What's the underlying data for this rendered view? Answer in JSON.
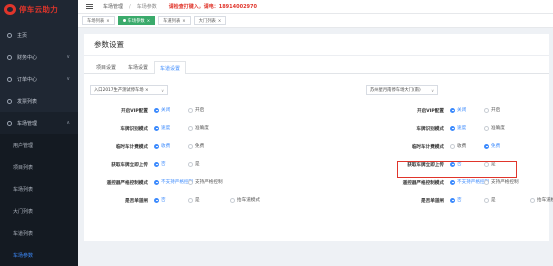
{
  "brand": {
    "name": "停车云助力"
  },
  "sidebar": {
    "items": [
      {
        "label": "主页"
      },
      {
        "label": "财务中心"
      },
      {
        "label": "订单中心"
      },
      {
        "label": "发票列表"
      },
      {
        "label": "车场管理"
      }
    ],
    "sub_items": [
      {
        "label": "用户管理"
      },
      {
        "label": "项目列表"
      },
      {
        "label": "车场列表"
      },
      {
        "label": "大门列表"
      },
      {
        "label": "车道列表"
      },
      {
        "label": "车场参数"
      }
    ]
  },
  "header": {
    "breadcrumb": [
      "车场管理",
      "车场参数"
    ],
    "notice": "请检查打键入，请电：18914002970"
  },
  "tags": [
    {
      "label": "车场列表"
    },
    {
      "label": "车场参数"
    },
    {
      "label": "车道列表"
    },
    {
      "label": "大门列表"
    }
  ],
  "page": {
    "title": "参数设置",
    "tabs": [
      {
        "label": "项目设置"
      },
      {
        "label": "车场设置"
      },
      {
        "label": "车道设置"
      }
    ],
    "select_left": "入口2017生产测试停车场 ×",
    "select_right": "苏州星月南停车场大门(南)"
  },
  "settings_left": [
    {
      "label": "开启VIP配置",
      "options": [
        "关闭",
        "开启"
      ],
      "selected": 0
    },
    {
      "label": "车牌识别模式",
      "options": [
        "速度",
        "准确度"
      ],
      "selected": 0
    },
    {
      "label": "临时车计费模式",
      "options": [
        "收费",
        "免费"
      ],
      "selected": 0
    },
    {
      "label": "获取车牌立即上传",
      "options": [
        "否",
        "是"
      ],
      "selected": 0
    },
    {
      "label": "遥控器严格控制模式",
      "options": [
        "不支持严格控制",
        "支持严格控制"
      ],
      "selected": 0
    },
    {
      "label": "是否单道闸",
      "options": [
        "否",
        "是",
        "抬车道模式"
      ],
      "selected": 0
    }
  ],
  "settings_right": [
    {
      "label": "开启VIP配置",
      "options": [
        "关闭",
        "开启"
      ],
      "selected": 0
    },
    {
      "label": "车牌识别模式",
      "options": [
        "速度",
        "准确度"
      ],
      "selected": 0
    },
    {
      "label": "临时车计费模式",
      "options": [
        "收费",
        "免费"
      ],
      "selected": 1
    },
    {
      "label": "获取车牌立即上传",
      "options": [
        "否",
        "是"
      ],
      "selected": 0
    },
    {
      "label": "遥控器严格控制模式",
      "options": [
        "不支持严格控制",
        "支持严格控制"
      ],
      "selected": 0
    },
    {
      "label": "是否单道闸",
      "options": [
        "否",
        "是",
        "抬车道模式"
      ],
      "selected": 0
    }
  ],
  "colors": {
    "accent": "#3d8bfd",
    "brand": "#e0352b",
    "sidebar": "#1f2733",
    "tag_active": "#3aaa6b"
  }
}
